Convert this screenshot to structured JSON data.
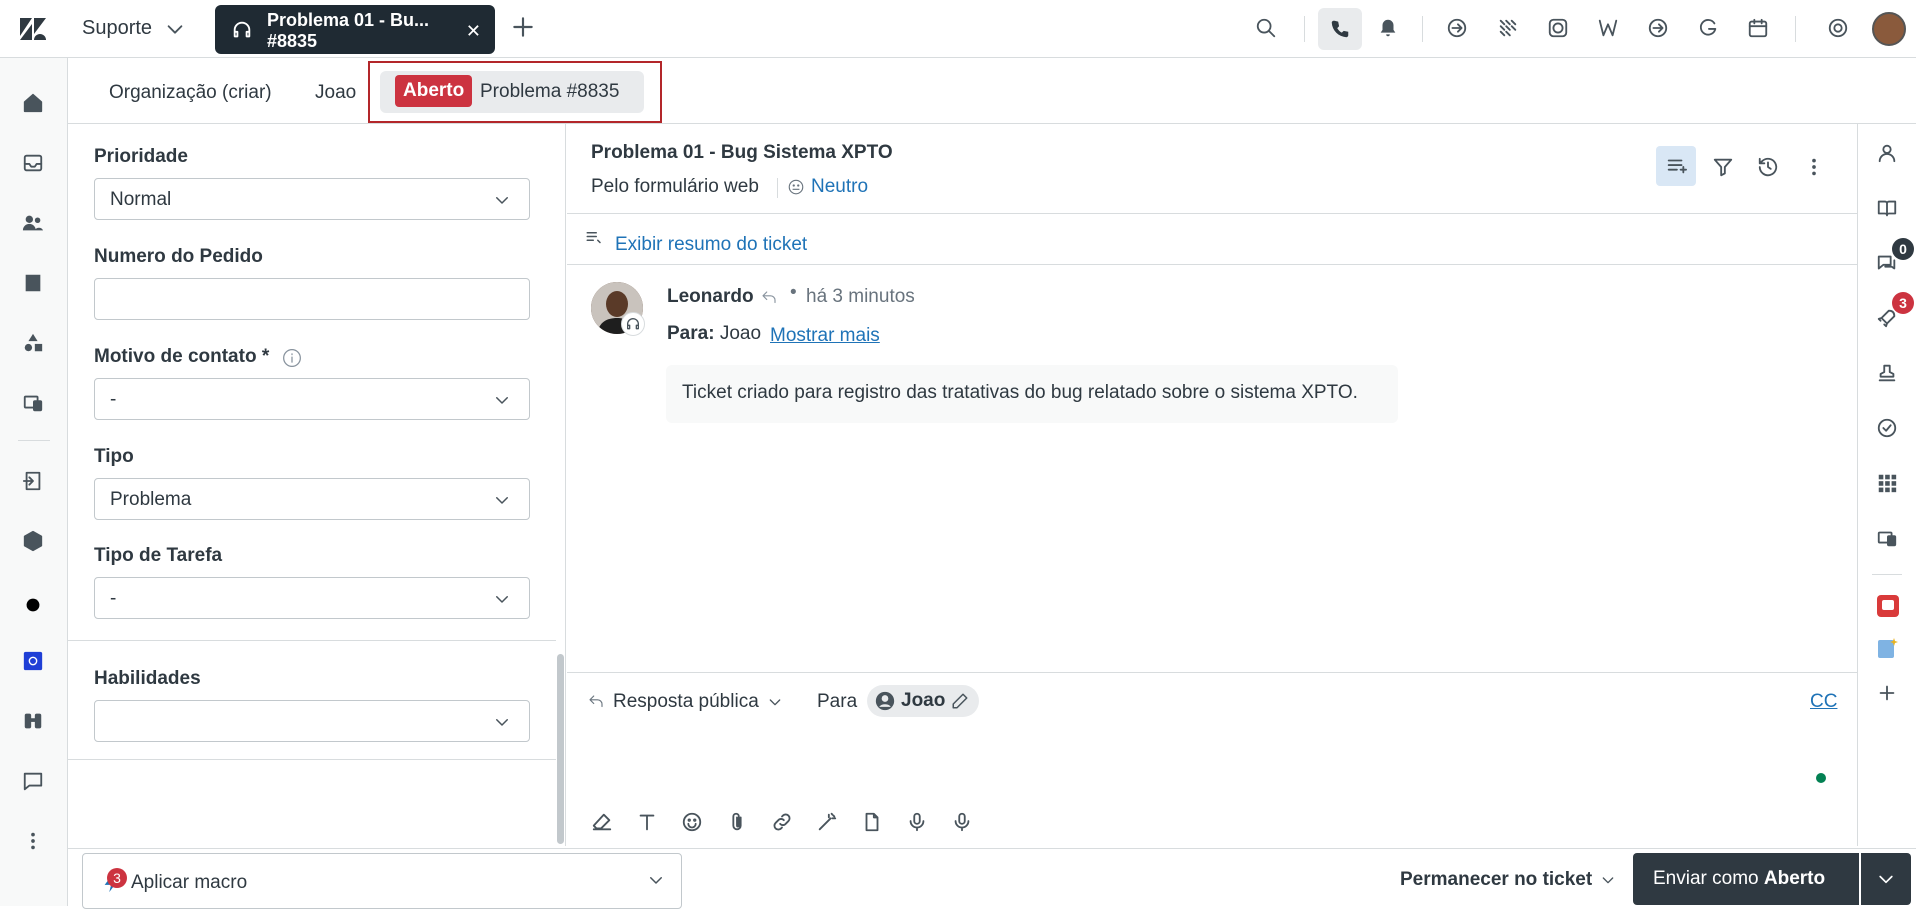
{
  "topbar": {
    "workspace": "Suporte",
    "ticket_tab": {
      "line1": "Problema 01  - Bu...",
      "line2": "#8835"
    }
  },
  "subtabs": {
    "organization": "Organização (criar)",
    "requester": "Joao",
    "status": "Aberto",
    "ticket": "Problema #8835"
  },
  "fields": {
    "priority": {
      "label": "Prioridade",
      "value": "Normal"
    },
    "order_number": {
      "label": "Numero do Pedido",
      "value": ""
    },
    "contact_reason": {
      "label": "Motivo de contato *",
      "value": "-"
    },
    "type": {
      "label": "Tipo",
      "value": "Problema"
    },
    "task_type": {
      "label": "Tipo de Tarefa",
      "value": "-"
    },
    "skills": {
      "label": "Habilidades",
      "value": ""
    }
  },
  "ticket": {
    "title": "Problema 01  - Bug Sistema XPTO",
    "via": "Pelo formulário web",
    "sentiment": "Neutro",
    "summary_link": "Exibir resumo do ticket"
  },
  "message": {
    "author": "Leonardo",
    "time": "há 3 minutos",
    "to_label": "Para:",
    "to_name": "Joao",
    "show_more": "Mostrar mais",
    "body": "Ticket criado para registro das tratativas do bug relatado sobre o sistema XPTO."
  },
  "composer": {
    "reply_type": "Resposta pública",
    "to_label": "Para",
    "recipient": "Joao",
    "cc": "CC"
  },
  "rightrail": {
    "chat_count": "0",
    "apps_count": "3"
  },
  "footer": {
    "macro": "Aplicar macro",
    "macro_badge": "3",
    "stay": "Permanecer no ticket",
    "submit_prefix": "Enviar como ",
    "submit_status": "Aberto"
  },
  "colors": {
    "accent": "#1f73b7",
    "status_open": "#cc3340",
    "dark": "#2f3941"
  }
}
